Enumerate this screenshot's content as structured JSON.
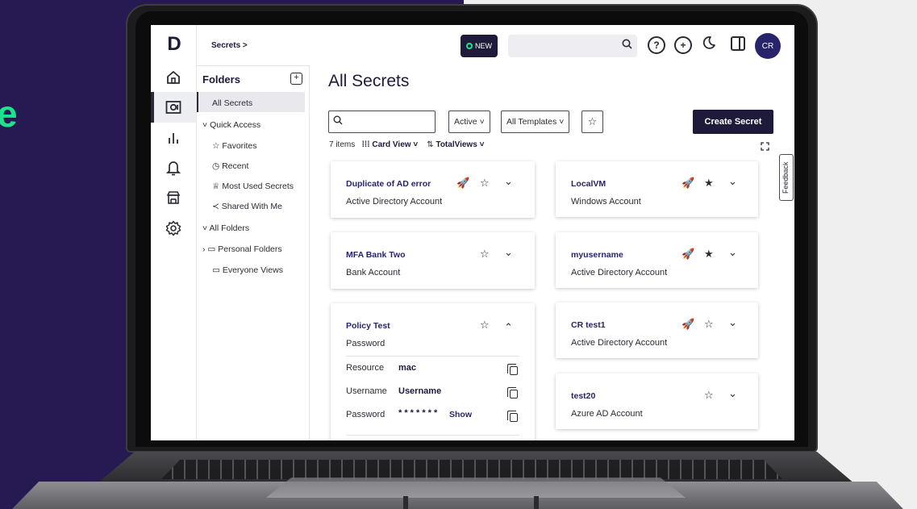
{
  "colors": {
    "brand": "#1d1a3a",
    "accent": "#19e68c",
    "link": "#28246b",
    "backdrop": "#271a52"
  },
  "background": {
    "edge_text": "e"
  },
  "app": {
    "logo_letter": "D",
    "rail_icons": [
      "home-icon",
      "vault-icon",
      "reports-icon",
      "bell-icon",
      "store-icon",
      "gear-icon"
    ]
  },
  "header": {
    "breadcrumb": "Secrets >",
    "new_badge": "NEW",
    "help_glyph": "?",
    "add_glyph": "+",
    "avatar_initials": "CR"
  },
  "folders": {
    "title": "Folders",
    "items": [
      {
        "label": "All Secrets"
      },
      {
        "label": "Quick Access",
        "toggle": "˅"
      },
      {
        "label": "Favorites",
        "icon": "☆"
      },
      {
        "label": "Recent",
        "icon": "◷"
      },
      {
        "label": "Most Used Secrets",
        "icon": "♕"
      },
      {
        "label": "Shared With Me",
        "icon": "≺"
      },
      {
        "label": "All Folders",
        "toggle": "˅"
      },
      {
        "label": "Personal Folders",
        "toggle": "›",
        "icon": "▭"
      },
      {
        "label": "Everyone Views",
        "icon": "▭"
      }
    ]
  },
  "main": {
    "title": "All Secrets",
    "search_placeholder": "",
    "filter_status": "Active",
    "filter_templates": "All Templates",
    "create_button": "Create Secret",
    "items_count": "7 items",
    "view_mode": "Card View",
    "sort_label": "TotalViews",
    "feedback_tab": "Feedback"
  },
  "cards": [
    {
      "title": "Duplicate of AD error",
      "subtitle": "Active Directory Account",
      "launcher": true,
      "favorite": false,
      "chevron": "⌄"
    },
    {
      "title": "LocalVM",
      "subtitle": "Windows Account",
      "launcher": true,
      "favorite": true,
      "chevron": "⌄"
    },
    {
      "title": "MFA Bank Two",
      "subtitle": "Bank Account",
      "launcher": false,
      "favorite": false,
      "chevron": "⌄"
    },
    {
      "title": "myusername",
      "subtitle": "Active Directory Account",
      "launcher": true,
      "favorite": true,
      "chevron": "⌄"
    },
    {
      "title": "Policy Test",
      "subtitle": "Password",
      "launcher": false,
      "favorite": false,
      "chevron": "⌃",
      "fields": [
        {
          "label": "Resource",
          "value": "mac"
        },
        {
          "label": "Username",
          "value": "Username"
        },
        {
          "label": "Password",
          "value": "* * * * * * *",
          "action": "Show"
        }
      ]
    },
    {
      "title": "CR test1",
      "subtitle": "Active Directory Account",
      "launcher": true,
      "favorite": false,
      "chevron": "⌄"
    },
    {
      "title": "test20",
      "subtitle": "Azure AD Account",
      "launcher": false,
      "favorite": false,
      "chevron": "⌄"
    }
  ]
}
